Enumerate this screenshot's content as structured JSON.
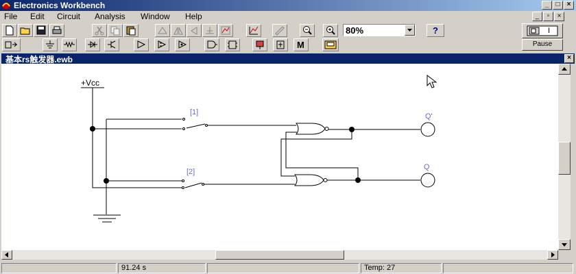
{
  "window": {
    "title": "Electronics Workbench"
  },
  "menu": [
    "File",
    "Edit",
    "Circuit",
    "Analysis",
    "Window",
    "Help"
  ],
  "toolbar": {
    "zoom": "80%",
    "help_label": "?",
    "pause_label": "Pause",
    "power_label": "I"
  },
  "parts_bin": {
    "meter_label": "M"
  },
  "document": {
    "title": "基本rs触发器.ewb"
  },
  "circuit": {
    "vcc_label": "+Vcc",
    "switch1_label": "[1]",
    "switch2_label": "[2]",
    "output_top_label": "Q'",
    "output_bottom_label": "Q"
  },
  "status": {
    "time": "91.24 s",
    "temp": "Temp:  27"
  },
  "colors": {
    "titlebar": "#0a246a",
    "label_blue": "#6a6ad8",
    "face": "#d4d0c8"
  }
}
